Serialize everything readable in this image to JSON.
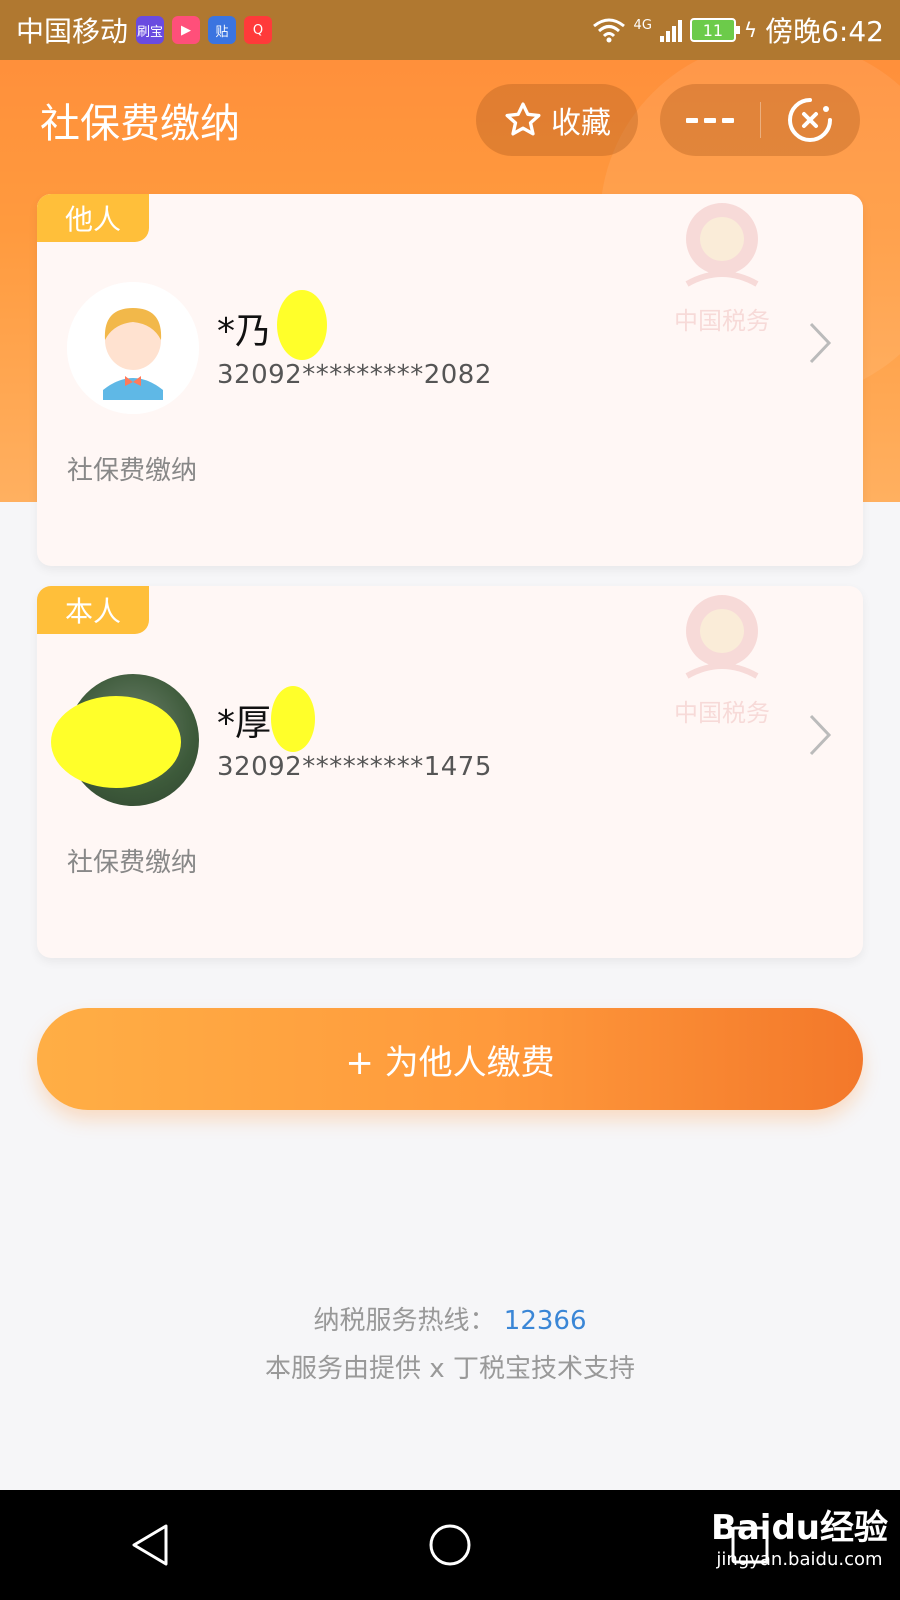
{
  "status_bar": {
    "carrier": "中国移动",
    "app_badges": [
      {
        "text": "刷宝",
        "color": "#6a4be0"
      },
      {
        "text": "▶",
        "color": "#ff4f7a"
      },
      {
        "text": "贴",
        "color": "#3b74e0"
      },
      {
        "text": "Q",
        "color": "#ff3a3a"
      }
    ],
    "network": "4G",
    "battery": "11",
    "time": "傍晚6:42"
  },
  "header": {
    "title": "社保费缴纳",
    "favorite_label": "收藏"
  },
  "cards": [
    {
      "tag": "他人",
      "name": "*乃",
      "id_masked": "32092*********2082",
      "service": "社保费缴纳",
      "avatar": "cartoon-avatar",
      "watermark_text": "中国税务"
    },
    {
      "tag": "本人",
      "name": "*厚",
      "id_masked": "32092*********1475",
      "service": "社保费缴纳",
      "avatar": "photo-avatar",
      "watermark_text": "中国税务"
    }
  ],
  "pay_button": {
    "label": "+ 为他人缴费"
  },
  "footer": {
    "hotline_label": "纳税服务热线：",
    "hotline_number": "12366",
    "support_text": "本服务由提供 x 丁税宝技术支持"
  },
  "watermark": {
    "brand": "Baidu经验",
    "url": "jingyan.baidu.com"
  },
  "colors": {
    "accent": "#ff9a3c",
    "tag": "#ffbf3a",
    "link": "#3a86d6"
  }
}
